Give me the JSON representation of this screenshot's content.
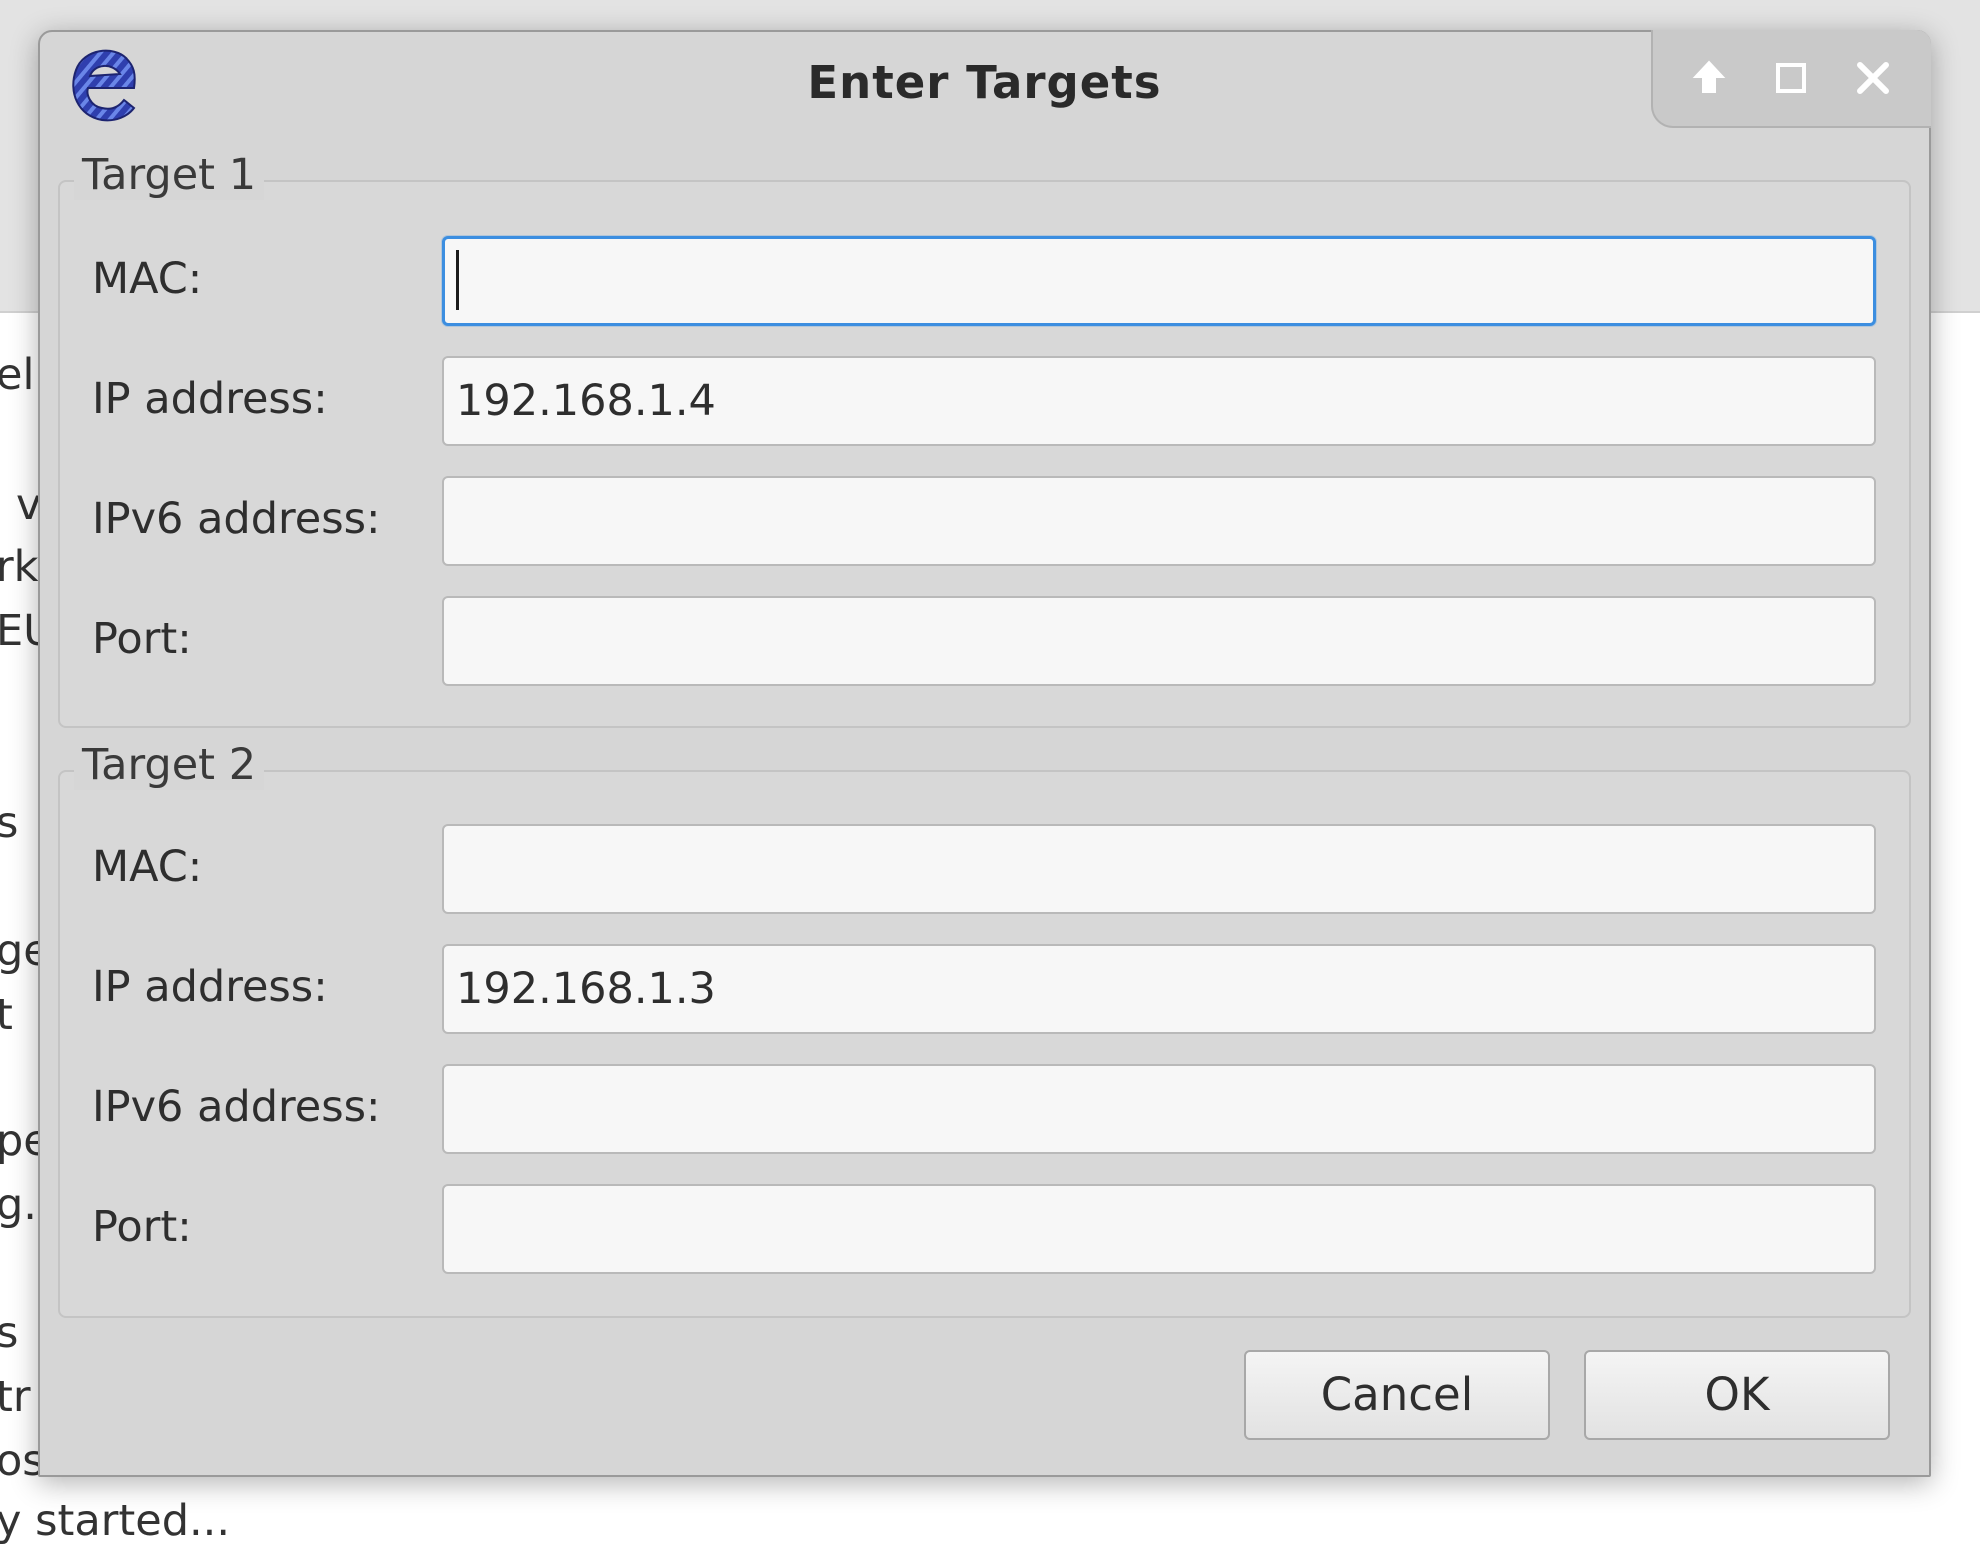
{
  "background": {
    "fragments": [
      "el",
      "v",
      "rk",
      "EU",
      "s",
      "ge",
      "t",
      "pe",
      "g.",
      "s",
      "tr",
      "os",
      "y started..."
    ]
  },
  "dialog": {
    "title": "Enter Targets",
    "icons": {
      "logo": "ettercap-logo",
      "up": "arrow-up-icon",
      "maximize": "maximize-icon",
      "close": "close-icon"
    },
    "target1": {
      "title": "Target 1",
      "mac_label": "MAC:",
      "mac_value": "",
      "ip_label": "IP address:",
      "ip_value": "192.168.1.4",
      "ipv6_label": "IPv6 address:",
      "ipv6_value": "",
      "port_label": "Port:",
      "port_value": ""
    },
    "target2": {
      "title": "Target 2",
      "mac_label": "MAC:",
      "mac_value": "",
      "ip_label": "IP address:",
      "ip_value": "192.168.1.3",
      "ipv6_label": "IPv6 address:",
      "ipv6_value": "",
      "port_label": "Port:",
      "port_value": ""
    },
    "buttons": {
      "cancel": "Cancel",
      "ok": "OK"
    }
  },
  "colors": {
    "focus": "#3c8ee0",
    "dialog_bg": "#d6d6d6",
    "field_bg": "#f7f7f7"
  }
}
